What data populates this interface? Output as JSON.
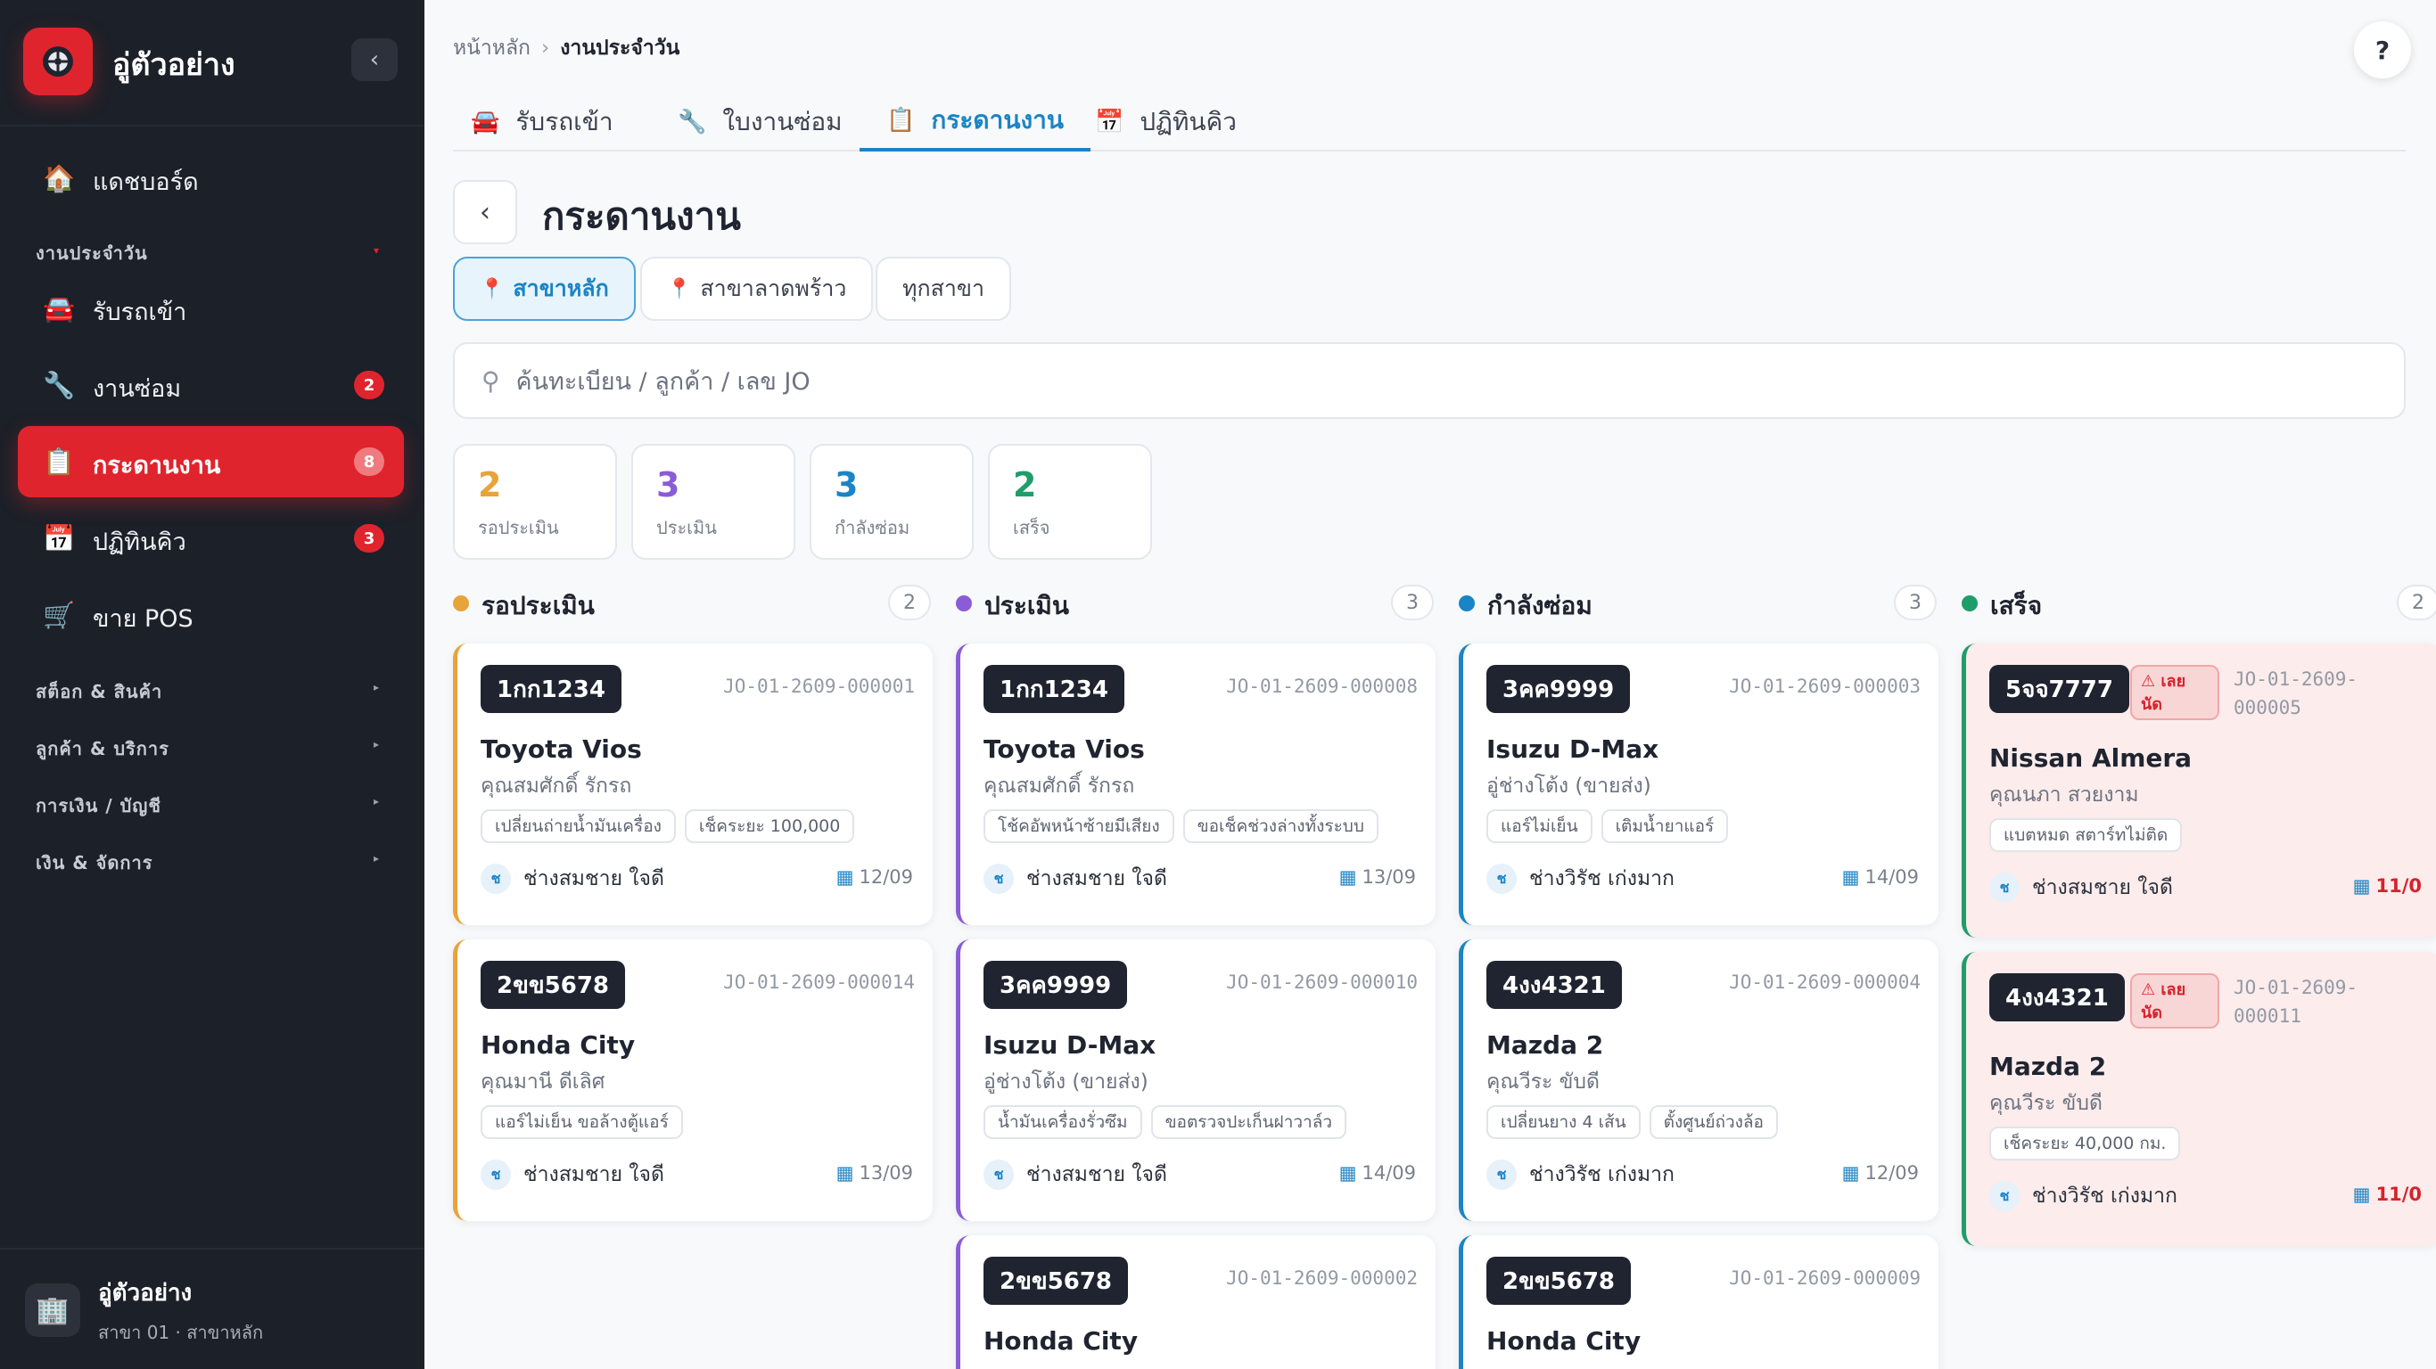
{
  "sidebar": {
    "brand": "อู่ตัวอย่าง",
    "collapse_icon": "‹",
    "dashboard": "แดชบอร์ด",
    "section_daily": "งานประจำวัน",
    "items": [
      {
        "label": "รับรถเข้า",
        "badge": ""
      },
      {
        "label": "งานซ่อม",
        "badge": "2"
      },
      {
        "label": "กระดานงาน",
        "badge": "8"
      },
      {
        "label": "ปฏิทินคิว",
        "badge": "3"
      },
      {
        "label": "ขาย POS",
        "badge": ""
      }
    ],
    "groups": [
      "สต็อก & สินค้า",
      "ลูกค้า & บริการ",
      "การเงิน / บัญชี",
      "เงิน & จัดการ"
    ],
    "footer": {
      "name": "อู่ตัวอย่าง",
      "branch": "สาขา 01 · สาขาหลัก"
    }
  },
  "breadcrumb": {
    "home": "หน้าหลัก",
    "current": "งานประจำวัน"
  },
  "help": "?",
  "tabs": [
    "รับรถเข้า",
    "ใบงานซ่อม",
    "กระดานงาน",
    "ปฏิทินคิว"
  ],
  "page": {
    "title": "กระดานงาน",
    "back": "‹"
  },
  "branches": [
    "สาขาหลัก",
    "สาขาลาดพร้าว",
    "ทุกสาขา"
  ],
  "search": {
    "placeholder": "ค้นทะเบียน / ลูกค้า / เลข JO"
  },
  "stats": [
    {
      "count": "2",
      "label": "รอประเมิน",
      "color": "#e8a33a"
    },
    {
      "count": "3",
      "label": "ประเมิน",
      "color": "#8a5cd6"
    },
    {
      "count": "3",
      "label": "กำลังซ่อม",
      "color": "#1a84c6"
    },
    {
      "count": "2",
      "label": "เสร็จ",
      "color": "#1f9d6a"
    }
  ],
  "columns": [
    {
      "title": "รอประเมิน",
      "count": "2",
      "color": "#e8a33a",
      "cards": [
        {
          "plate": "1กก1234",
          "jo": "JO-01-2609-000001",
          "car": "Toyota Vios",
          "customer": "คุณสมศักดิ์ รักรถ",
          "tags": [
            "เปลี่ยนถ่ายน้ำมันเครื่อง",
            "เช็คระยะ 100,000"
          ],
          "tech_initial": "ช",
          "tech": "ช่างสมชาย ใจดี",
          "due": "12/09"
        },
        {
          "plate": "2ขข5678",
          "jo": "JO-01-2609-000014",
          "car": "Honda City",
          "customer": "คุณมานี ดีเลิศ",
          "tags": [
            "แอร์ไม่เย็น ขอล้างตู้แอร์"
          ],
          "tech_initial": "ช",
          "tech": "ช่างสมชาย ใจดี",
          "due": "13/09"
        }
      ]
    },
    {
      "title": "ประเมิน",
      "count": "3",
      "color": "#8a5cd6",
      "cards": [
        {
          "plate": "1กก1234",
          "jo": "JO-01-2609-000008",
          "car": "Toyota Vios",
          "customer": "คุณสมศักดิ์ รักรถ",
          "tags": [
            "โช้คอัพหน้าซ้ายมีเสียง",
            "ขอเช็คช่วงล่างทั้งระบบ"
          ],
          "tech_initial": "ช",
          "tech": "ช่างสมชาย ใจดี",
          "due": "13/09"
        },
        {
          "plate": "3คค9999",
          "jo": "JO-01-2609-000010",
          "car": "Isuzu D-Max",
          "customer": "อู่ช่างโต้ง (ขายส่ง)",
          "tags": [
            "น้ำมันเครื่องรั่วซึม",
            "ขอตรวจปะเก็นฝาวาล์ว"
          ],
          "tech_initial": "ช",
          "tech": "ช่างสมชาย ใจดี",
          "due": "14/09"
        },
        {
          "plate": "2ขข5678",
          "jo": "JO-01-2609-000002",
          "car": "Honda City"
        }
      ]
    },
    {
      "title": "กำลังซ่อม",
      "count": "3",
      "color": "#1a84c6",
      "cards": [
        {
          "plate": "3คค9999",
          "jo": "JO-01-2609-000003",
          "car": "Isuzu D-Max",
          "customer": "อู่ช่างโต้ง (ขายส่ง)",
          "tags": [
            "แอร์ไม่เย็น",
            "เติมน้ำยาแอร์"
          ],
          "tech_initial": "ช",
          "tech": "ช่างวิรัช เก่งมาก",
          "due": "14/09"
        },
        {
          "plate": "4งง4321",
          "jo": "JO-01-2609-000004",
          "car": "Mazda 2",
          "customer": "คุณวีระ ขับดี",
          "tags": [
            "เปลี่ยนยาง 4 เส้น",
            "ตั้งศูนย์ถ่วงล้อ"
          ],
          "tech_initial": "ช",
          "tech": "ช่างวิรัช เก่งมาก",
          "due": "12/09"
        },
        {
          "plate": "2ขข5678",
          "jo": "JO-01-2609-000009",
          "car": "Honda City"
        }
      ]
    },
    {
      "title": "เสร็จ",
      "count": "2",
      "color": "#1f9d6a",
      "cards": [
        {
          "plate": "5จจ7777",
          "late": "⚠ เลย นัด",
          "jo_line1": "JO-01-2609-",
          "jo_line2": "000005",
          "car": "Nissan Almera",
          "customer": "คุณนภา สวยงาม",
          "tags": [
            "แบตหมด สตาร์ทไม่ติด"
          ],
          "tech_initial": "ช",
          "tech": "ช่างสมชาย ใจดี",
          "due": "11/0"
        },
        {
          "plate": "4งง4321",
          "late": "⚠ เลย นัด",
          "jo_line1": "JO-01-2609-",
          "jo_line2": "000011",
          "car": "Mazda 2",
          "customer": "คุณวีระ ขับดี",
          "tags": [
            "เช็คระยะ 40,000 กม."
          ],
          "tech_initial": "ช",
          "tech": "ช่างวิรัช เก่งมาก",
          "due": "11/0"
        }
      ]
    }
  ]
}
